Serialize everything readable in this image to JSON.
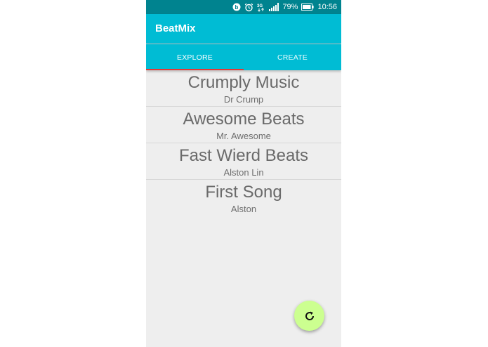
{
  "status_bar": {
    "battery_percent": "79%",
    "time": "10:56",
    "network": "3G",
    "icons": [
      "beats-icon",
      "alarm-icon",
      "network-3g-icon",
      "signal-icon",
      "battery-icon"
    ]
  },
  "app_bar": {
    "title": "BeatMix"
  },
  "tabs": [
    {
      "label": "EXPLORE",
      "selected": true
    },
    {
      "label": "CREATE",
      "selected": false
    }
  ],
  "songs": [
    {
      "title": "Crumply Music",
      "artist": "Dr Crump"
    },
    {
      "title": "Awesome Beats",
      "artist": "Mr. Awesome"
    },
    {
      "title": "Fast Wierd Beats",
      "artist": "Alston Lin"
    },
    {
      "title": "First Song",
      "artist": "Alston"
    }
  ],
  "fab": {
    "icon": "refresh-icon"
  },
  "colors": {
    "status_bar": "#00838f",
    "app_bar": "#00bcd4",
    "tab_indicator": "#e53935",
    "fab": "#ccff90",
    "background": "#eeeeee"
  }
}
